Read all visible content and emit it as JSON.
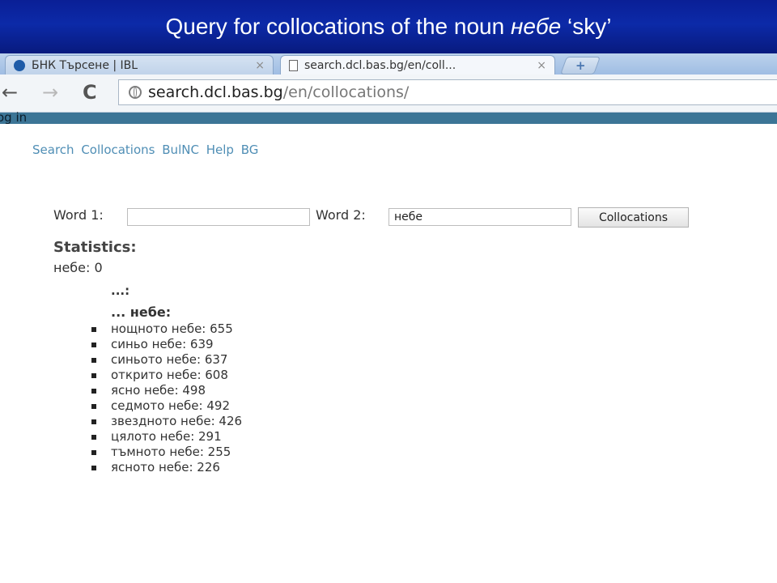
{
  "slide": {
    "title_part1": "Query for collocations of the noun ",
    "title_italic": "небе",
    "title_part2": " ‘sky’"
  },
  "browser": {
    "tabs": [
      {
        "label": "БНК Търсене | IBL",
        "close": "×",
        "active": false
      },
      {
        "label": "search.dcl.bas.bg/en/coll...",
        "close": "×",
        "active": true
      }
    ],
    "new_tab_icon": "+",
    "nav": {
      "back": "←",
      "forward": "→",
      "reload": "C"
    },
    "address": {
      "host": "search.dcl.bas.bg",
      "path": "/en/collocations/"
    }
  },
  "site": {
    "topbar_link": "og in",
    "nav_links": [
      "Search",
      "Collocations",
      "BulNC",
      "Help",
      "BG"
    ]
  },
  "form": {
    "word1_label": "Word 1:",
    "word1_value": "",
    "word2_label": "Word 2:",
    "word2_value": "небе",
    "submit_label": "Collocations"
  },
  "results": {
    "statistics_heading": "Statistics:",
    "total": "небе: 0",
    "left_heading": "...:",
    "right_heading": "... небе:",
    "collocations": [
      "нощното небе: 655",
      "синьо небе: 639",
      "синьото небе: 637",
      "открито небе: 608",
      "ясно небе: 498",
      "седмото небе: 492",
      "звездното небе: 426",
      "цялото небе: 291",
      "тъмното небе: 255",
      "ясното небе: 226"
    ]
  }
}
